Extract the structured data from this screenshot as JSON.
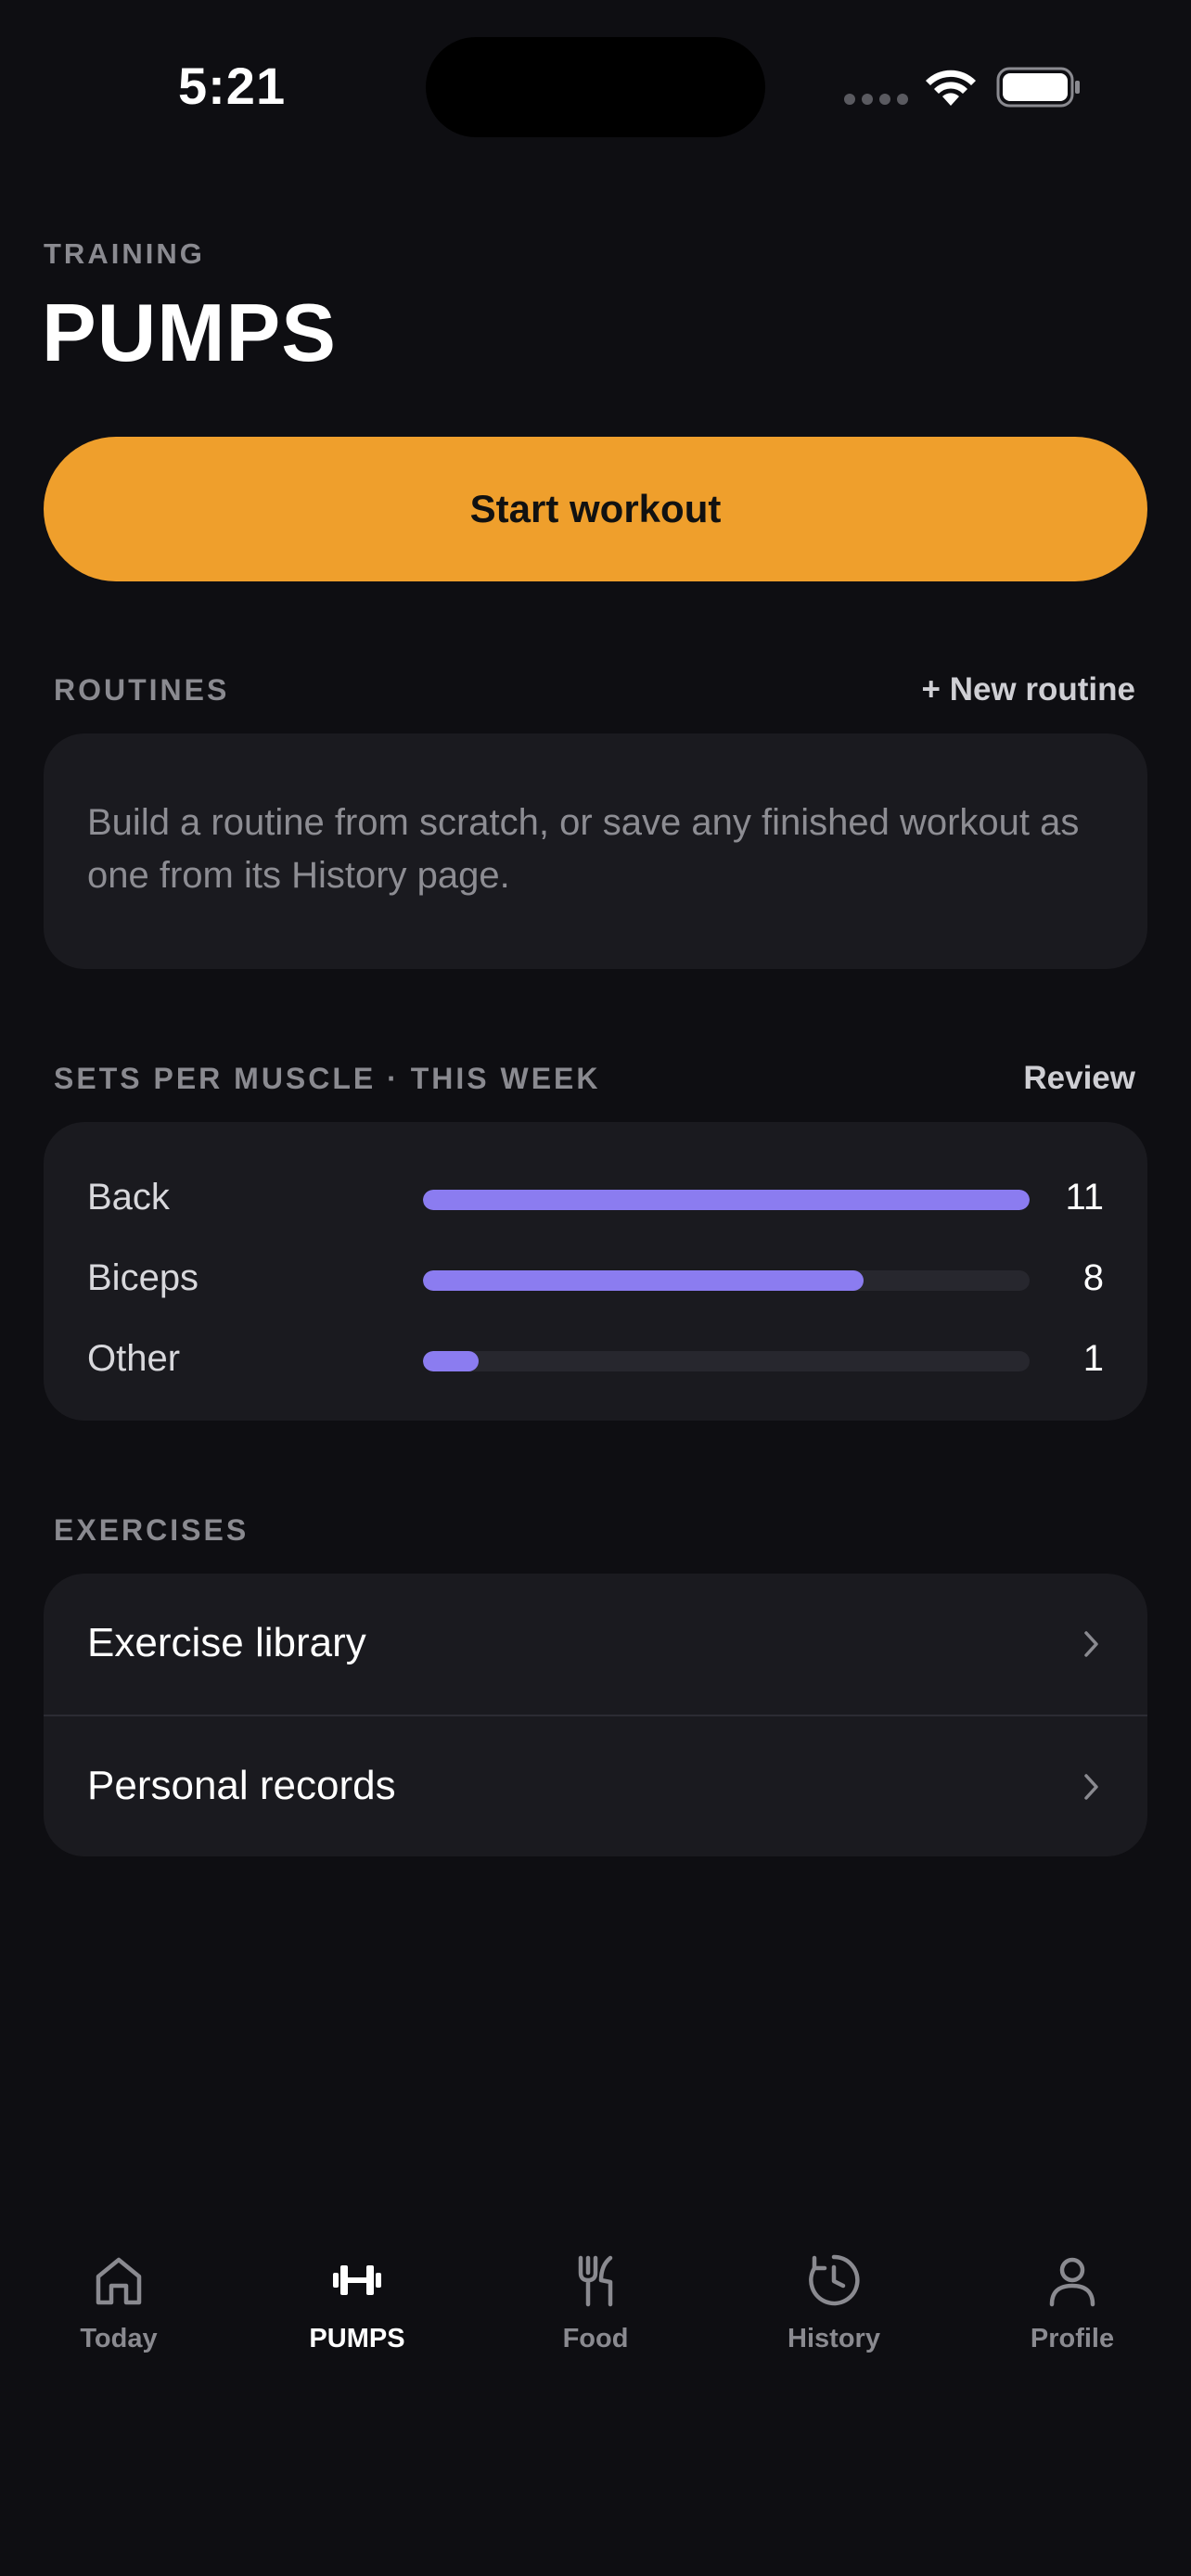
{
  "status_bar": {
    "time": "5:21"
  },
  "header": {
    "eyebrow": "TRAINING",
    "title": "PUMPS"
  },
  "primary_action": {
    "label": "Start workout",
    "color": "#ef9f2c"
  },
  "routines": {
    "label": "ROUTINES",
    "action_label": "+ New routine",
    "empty_text": "Build a routine from scratch, or save any finished workout as one from its History page."
  },
  "sets_per_muscle": {
    "label": "SETS PER MUSCLE · THIS WEEK",
    "action_label": "Review",
    "bar_color": "#8b7cf0",
    "max": 11,
    "rows": [
      {
        "name": "Back",
        "count": 11,
        "fraction": 1.0
      },
      {
        "name": "Biceps",
        "count": 8,
        "fraction": 0.727
      },
      {
        "name": "Other",
        "count": 1,
        "fraction": 0.091
      }
    ]
  },
  "exercises": {
    "label": "EXERCISES",
    "items": [
      {
        "label": "Exercise library",
        "icon": "chevron-right-icon"
      },
      {
        "label": "Personal records",
        "icon": "chevron-right-icon"
      }
    ]
  },
  "tab_bar": {
    "active": "PUMPS",
    "tabs": [
      {
        "label": "Today",
        "icon": "home-icon"
      },
      {
        "label": "PUMPS",
        "icon": "dumbbell-icon"
      },
      {
        "label": "Food",
        "icon": "fork-knife-icon"
      },
      {
        "label": "History",
        "icon": "history-icon"
      },
      {
        "label": "Profile",
        "icon": "person-icon"
      }
    ]
  }
}
